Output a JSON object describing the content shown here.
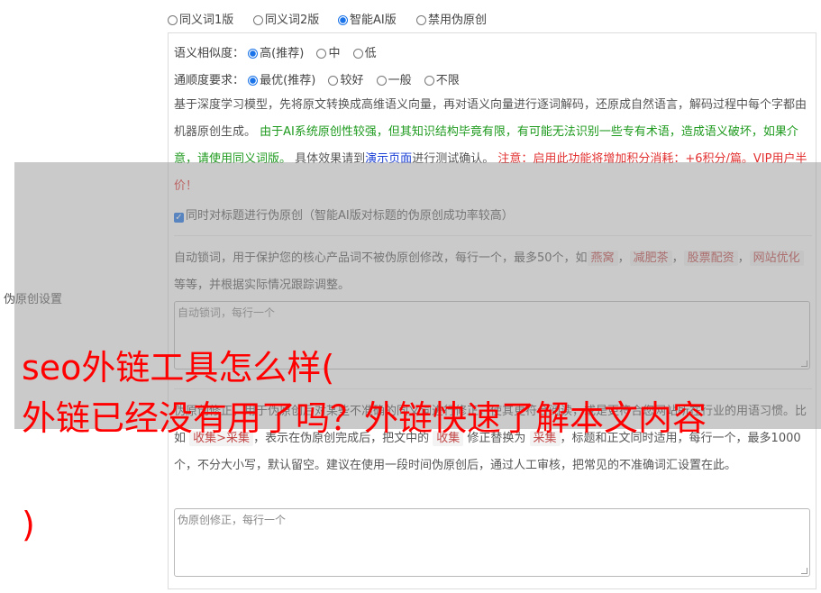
{
  "versions": [
    {
      "label": "同义词1版",
      "selected": false
    },
    {
      "label": "同义词2版",
      "selected": false
    },
    {
      "label": "智能AI版",
      "selected": true
    },
    {
      "label": "禁用伪原创",
      "selected": false
    }
  ],
  "side_label": "伪原创设置",
  "similarity": {
    "label": "语义相似度：",
    "options": [
      {
        "label": "高(推荐)",
        "selected": true
      },
      {
        "label": "中",
        "selected": false
      },
      {
        "label": "低",
        "selected": false
      }
    ]
  },
  "fluency": {
    "label": "通顺度要求：",
    "options": [
      {
        "label": "最优(推荐)",
        "selected": true
      },
      {
        "label": "较好",
        "selected": false
      },
      {
        "label": "一般",
        "selected": false
      },
      {
        "label": "不限",
        "selected": false
      }
    ]
  },
  "description": {
    "intro": "基于深度学习模型，先将原文转换成高维语义向量，再对语义向量进行逐词解码，还原成自然语言，解码过程中每个字都由机器原创生成。",
    "green_note": "由于AI系统原创性较强，但其知识结构毕竟有限，有可能无法识别一些专有术语，造成语义破坏，如果介意，请使用同义词版。",
    "demo_prefix": "具体效果请到",
    "demo_link": "演示页面",
    "demo_suffix": "进行测试确认。",
    "red_note": "注意：启用此功能将增加积分消耗：+6积分/篇。VIP用户半价！"
  },
  "title_checkbox": {
    "label": "同时对标题进行伪原创（智能AI版对标题的伪原创成功率较高）",
    "checked": true
  },
  "lock_words": {
    "text_prefix": "自动锁词，用于保护您的核心产品词不被伪原创修改，每行一个，最多50个，如",
    "examples": [
      "燕窝",
      "减肥茶",
      "股票配资",
      "网站优化"
    ],
    "text_suffix": "等等，并根据实际情况跟踪调整。",
    "placeholder": "自动锁词，每行一个"
  },
  "correction": {
    "text_a": "伪原创修正，用于伪原创后对某些不准确的同义词进行修正，使其更符合阅读，或是更符合您网站所在行业的用语习惯。比如",
    "example": "收集>采集",
    "text_b": "，表示在伪原创完成后，把文中的",
    "from": "收集",
    "text_c": "修正替换为",
    "to": "采集",
    "text_d": "，标题和正文同时适用，每行一个，最多1000个，不分大小写，默认留空。建议在使用一段时间伪原创后，通过人工审核，把常见的不准确词汇设置在此。",
    "placeholder": "伪原创修正，每行一个"
  },
  "headline": {
    "line1": "seo外链工具怎么样(",
    "line2": "外链已经没有用了吗？外链快速了解本文内容",
    "line3": ")"
  }
}
